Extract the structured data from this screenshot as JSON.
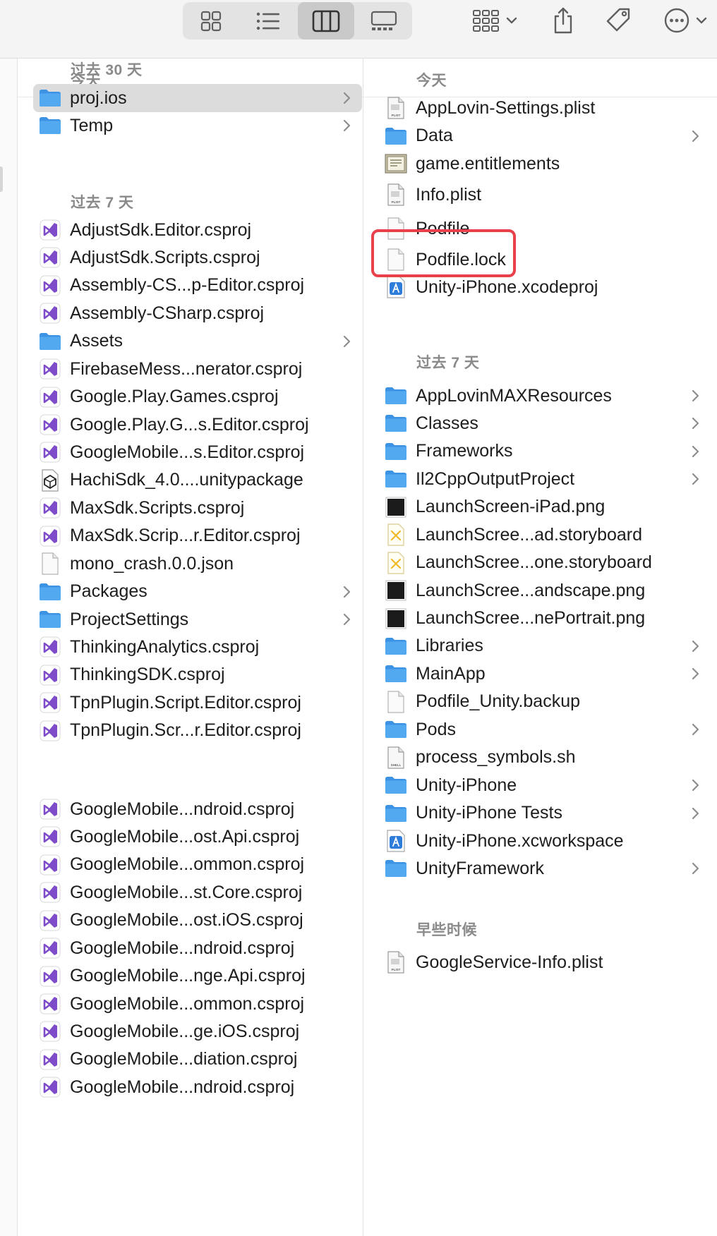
{
  "toolbar": {
    "view_buttons": [
      "icon-view",
      "list-view",
      "column-view",
      "gallery-view"
    ],
    "active_view": "column-view",
    "actions": [
      "group-by",
      "share",
      "tags",
      "more"
    ]
  },
  "col1": {
    "header": "今天",
    "sections": [
      {
        "title": "",
        "items": [
          {
            "name": "proj.ios",
            "type": "folder",
            "selected": true
          },
          {
            "name": "Temp",
            "type": "folder"
          }
        ]
      },
      {
        "title": "过去 7 天",
        "items": [
          {
            "name": "AdjustSdk.Editor.csproj",
            "type": "csproj"
          },
          {
            "name": "AdjustSdk.Scripts.csproj",
            "type": "csproj"
          },
          {
            "name": "Assembly-CS...p-Editor.csproj",
            "type": "csproj"
          },
          {
            "name": "Assembly-CSharp.csproj",
            "type": "csproj"
          },
          {
            "name": "Assets",
            "type": "folder"
          },
          {
            "name": "FirebaseMess...nerator.csproj",
            "type": "csproj"
          },
          {
            "name": "Google.Play.Games.csproj",
            "type": "csproj"
          },
          {
            "name": "Google.Play.G...s.Editor.csproj",
            "type": "csproj"
          },
          {
            "name": "GoogleMobile...s.Editor.csproj",
            "type": "csproj"
          },
          {
            "name": "HachiSdk_4.0....unitypackage",
            "type": "unity"
          },
          {
            "name": "MaxSdk.Scripts.csproj",
            "type": "csproj"
          },
          {
            "name": "MaxSdk.Scrip...r.Editor.csproj",
            "type": "csproj"
          },
          {
            "name": "mono_crash.0.0.json",
            "type": "doc"
          },
          {
            "name": "Packages",
            "type": "folder"
          },
          {
            "name": "ProjectSettings",
            "type": "folder"
          },
          {
            "name": "ThinkingAnalytics.csproj",
            "type": "csproj"
          },
          {
            "name": "ThinkingSDK.csproj",
            "type": "csproj"
          },
          {
            "name": "TpnPlugin.Script.Editor.csproj",
            "type": "csproj"
          },
          {
            "name": "TpnPlugin.Scr...r.Editor.csproj",
            "type": "csproj"
          }
        ]
      },
      {
        "title": "过去 30 天",
        "items": [
          {
            "name": "GoogleMobile...ndroid.csproj",
            "type": "csproj"
          },
          {
            "name": "GoogleMobile...ost.Api.csproj",
            "type": "csproj"
          },
          {
            "name": "GoogleMobile...ommon.csproj",
            "type": "csproj"
          },
          {
            "name": "GoogleMobile...st.Core.csproj",
            "type": "csproj"
          },
          {
            "name": "GoogleMobile...ost.iOS.csproj",
            "type": "csproj"
          },
          {
            "name": "GoogleMobile...ndroid.csproj",
            "type": "csproj"
          },
          {
            "name": "GoogleMobile...nge.Api.csproj",
            "type": "csproj"
          },
          {
            "name": "GoogleMobile...ommon.csproj",
            "type": "csproj"
          },
          {
            "name": "GoogleMobile...ge.iOS.csproj",
            "type": "csproj"
          },
          {
            "name": "GoogleMobile...diation.csproj",
            "type": "csproj"
          },
          {
            "name": "GoogleMobile...ndroid.csproj",
            "type": "csproj"
          }
        ]
      }
    ]
  },
  "col2": {
    "header": "今天",
    "sections": [
      {
        "title": "",
        "items": [
          {
            "name": "AppLovin-Settings.plist",
            "type": "plist"
          },
          {
            "name": "Data",
            "type": "folder"
          },
          {
            "name": "game.entitlements",
            "type": "entitlements"
          },
          {
            "name": "Info.plist",
            "type": "plist"
          },
          {
            "name": "Podfile",
            "type": "blank"
          },
          {
            "name": "Podfile.lock",
            "type": "blank"
          },
          {
            "name": "Unity-iPhone.xcodeproj",
            "type": "xcode"
          }
        ]
      },
      {
        "title": "过去 7 天",
        "items": [
          {
            "name": "AppLovinMAXResources",
            "type": "folder"
          },
          {
            "name": "Classes",
            "type": "folder"
          },
          {
            "name": "Frameworks",
            "type": "folder"
          },
          {
            "name": "Il2CppOutputProject",
            "type": "folder"
          },
          {
            "name": "LaunchScreen-iPad.png",
            "type": "png"
          },
          {
            "name": "LaunchScree...ad.storyboard",
            "type": "storyboard"
          },
          {
            "name": "LaunchScree...one.storyboard",
            "type": "storyboard"
          },
          {
            "name": "LaunchScree...andscape.png",
            "type": "png"
          },
          {
            "name": "LaunchScree...nePortrait.png",
            "type": "png"
          },
          {
            "name": "Libraries",
            "type": "folder"
          },
          {
            "name": "MainApp",
            "type": "folder"
          },
          {
            "name": "Podfile_Unity.backup",
            "type": "blank"
          },
          {
            "name": "Pods",
            "type": "folder"
          },
          {
            "name": "process_symbols.sh",
            "type": "shell"
          },
          {
            "name": "Unity-iPhone",
            "type": "folder"
          },
          {
            "name": "Unity-iPhone Tests",
            "type": "folder"
          },
          {
            "name": "Unity-iPhone.xcworkspace",
            "type": "xcworkspace"
          },
          {
            "name": "UnityFramework",
            "type": "folder"
          }
        ]
      },
      {
        "title": "早些时候",
        "items": [
          {
            "name": "GoogleService-Info.plist",
            "type": "plist"
          }
        ]
      }
    ]
  },
  "colors": {
    "folder": "#52a9f0",
    "csproj": "#7e4cc9",
    "highlight": "#e8414b",
    "selection": "#dcdcdc"
  }
}
